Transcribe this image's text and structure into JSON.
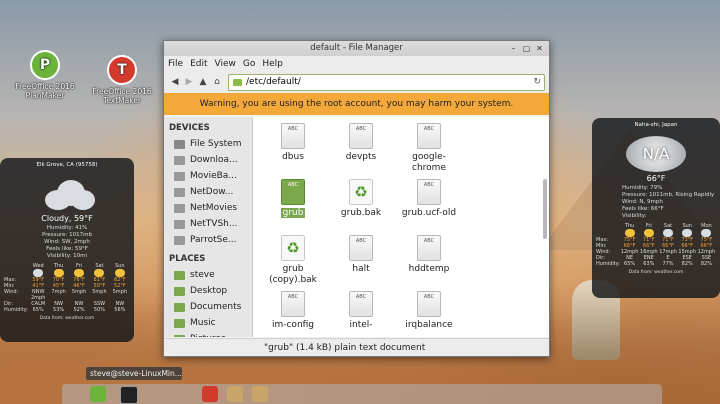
{
  "desktop": {
    "icons": [
      {
        "letter": "P",
        "line1": "FreeOffice 2016",
        "line2": "PlanMaker",
        "color": "#6bb33a"
      },
      {
        "letter": "T",
        "line1": "FreeOffice 2016",
        "line2": "TextMaker",
        "color": "#d33a2c"
      }
    ]
  },
  "weather_left": {
    "location": "Elk Grove, CA (95758)",
    "condition": "Cloudy, 59°F",
    "details": [
      "Humidity: 41%",
      "Pressure: 1017mb",
      "Wind: SW, 2mph",
      "Feels like: 59°F",
      "Visibility: 10mi"
    ],
    "days": [
      "Wed",
      "Thu",
      "Fri",
      "Sat",
      "Sun"
    ],
    "rows": [
      {
        "label": "Max:",
        "values": [
          "59°F",
          "70°F",
          "76°F",
          "81°F",
          "82°F"
        ]
      },
      {
        "label": "Min:",
        "values": [
          "41°F",
          "45°F",
          "46°F",
          "50°F",
          "52°F"
        ]
      },
      {
        "label": "Wind:",
        "values": [
          "NNW 2mph",
          "7mph",
          "5mph",
          "5mph",
          "5mph"
        ]
      },
      {
        "label": "Dir:",
        "values": [
          "CALM",
          "NW",
          "NW",
          "SSW",
          "NW"
        ]
      },
      {
        "label": "Humidity:",
        "values": [
          "65%",
          "53%",
          "52%",
          "50%",
          "56%"
        ]
      }
    ],
    "footer": "Data from: weather.com"
  },
  "weather_right": {
    "location": "Naha-shi, Japan",
    "icon_text": "N/A",
    "temp": "66°F",
    "details": [
      "Humidity: 79%",
      "Pressure: 1011mb, Rising Rapidly",
      "Wind: N, 9mph",
      "Feels like: 66°F",
      "Visibility:"
    ],
    "days": [
      "Thu",
      "Fri",
      "Sat",
      "Sun",
      "Mon"
    ],
    "rows": [
      {
        "label": "Max:",
        "values": [
          "75°F",
          "71°F",
          "71°F",
          "73°F",
          "75°F"
        ]
      },
      {
        "label": "Min:",
        "values": [
          "66°F",
          "66°F",
          "66°F",
          "66°F",
          "66°F"
        ]
      },
      {
        "label": "Wind:",
        "values": [
          "12mph",
          "16mph",
          "17mph",
          "15mph",
          "12mph"
        ]
      },
      {
        "label": "Dir:",
        "values": [
          "NE",
          "ENE",
          "E",
          "ESE",
          "SSE"
        ]
      },
      {
        "label": "Humidity:",
        "values": [
          "65%",
          "63%",
          "77%",
          "82%",
          "82%"
        ]
      }
    ],
    "footer": "Data from: weather.com"
  },
  "file_manager": {
    "title": "default - File Manager",
    "menu": [
      "File",
      "Edit",
      "View",
      "Go",
      "Help"
    ],
    "nav": {
      "back": "◀",
      "forward": "▶",
      "up": "▲",
      "home": "⌂"
    },
    "address": "/etc/default/",
    "warning": "Warning, you are using the root account, you may harm your system.",
    "sidebar": {
      "devices_header": "DEVICES",
      "devices": [
        {
          "label": "File System",
          "icon": "drive-icon",
          "color": "#888888"
        },
        {
          "label": "Downloa...",
          "icon": "drive-icon",
          "color": "#999999"
        },
        {
          "label": "MovieBa...",
          "icon": "drive-icon",
          "color": "#999999"
        },
        {
          "label": "NetDow...",
          "icon": "drive-icon",
          "color": "#999999"
        },
        {
          "label": "NetMovies",
          "icon": "drive-icon",
          "color": "#999999"
        },
        {
          "label": "NetTVSh...",
          "icon": "drive-icon",
          "color": "#999999"
        },
        {
          "label": "ParrotSe...",
          "icon": "drive-icon",
          "color": "#999999"
        }
      ],
      "places_header": "PLACES",
      "places": [
        {
          "label": "steve",
          "icon": "home-icon",
          "color": "#7aa84a"
        },
        {
          "label": "Desktop",
          "icon": "folder-icon",
          "color": "#7aa84a"
        },
        {
          "label": "Documents",
          "icon": "folder-icon",
          "color": "#7aa84a"
        },
        {
          "label": "Music",
          "icon": "folder-icon",
          "color": "#7aa84a"
        },
        {
          "label": "Pictures",
          "icon": "folder-icon",
          "color": "#7aa84a"
        }
      ]
    },
    "files": [
      {
        "name": "dbus",
        "type": "text",
        "thumb": "ABC"
      },
      {
        "name": "devpts",
        "type": "text",
        "thumb": "ABC"
      },
      {
        "name": "google-chrome",
        "type": "text",
        "thumb": "ABC"
      },
      {
        "name": "grub",
        "type": "selected",
        "thumb": "ABC"
      },
      {
        "name": "grub.bak",
        "type": "recycle",
        "thumb": "♻"
      },
      {
        "name": "grub.ucf-old",
        "type": "text",
        "thumb": "ABC"
      },
      {
        "name": "grub (copy).bak",
        "type": "recycle",
        "thumb": "♻"
      },
      {
        "name": "halt",
        "type": "text",
        "thumb": "ABC"
      },
      {
        "name": "hddtemp",
        "type": "text",
        "thumb": "ABC"
      },
      {
        "name": "im-config",
        "type": "text",
        "thumb": "ABC"
      },
      {
        "name": "intel-",
        "type": "text",
        "thumb": "ABC"
      },
      {
        "name": "irqbalance",
        "type": "text",
        "thumb": "ABC"
      }
    ],
    "status": "\"grub\" (1.4 kB) plain text document"
  },
  "taskbar": {
    "terminal_button": "steve@steve-LinuxMin..."
  }
}
